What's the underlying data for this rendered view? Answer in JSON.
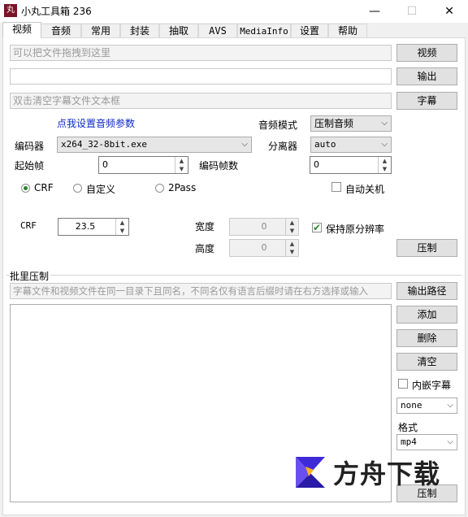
{
  "window": {
    "title": "小丸工具箱 236",
    "app_icon": "丸",
    "minimize": "—",
    "maximize": "☐",
    "close": "✕"
  },
  "tabs": [
    "视频",
    "音频",
    "常用",
    "封装",
    "抽取",
    "AVS",
    "MediaInfo",
    "设置",
    "帮助"
  ],
  "video": {
    "placeholder_drag": "可以把文件拖拽到这里",
    "video_button": "视频",
    "output_field": "",
    "output_button": "输出",
    "placeholder_subtitle": "双击清空字幕文件文本框",
    "subtitle_button": "字幕",
    "audio_settings_link": "点我设置音频参数",
    "audio_mode_label": "音频模式",
    "audio_mode_value": "压制音频",
    "encoder_label": "编码器",
    "encoder_value": "x264_32-8bit.exe",
    "splitter_label": "分离器",
    "splitter_value": "auto",
    "start_frame_label": "起始帧",
    "start_frame_value": "0",
    "frame_count_label": "编码帧数",
    "frame_count_value": "0",
    "mode_crf": "CRF",
    "mode_custom": "自定义",
    "mode_2pass": "2Pass",
    "auto_shutdown": "自动关机",
    "crf_label": "CRF",
    "crf_value": "23.5",
    "width_label": "宽度",
    "width_value": "0",
    "height_label": "高度",
    "height_value": "0",
    "keep_resolution": "保持原分辨率",
    "encode_button": "压制"
  },
  "batch": {
    "title": "批里压制",
    "placeholder_hint": "字幕文件和视频文件在同一目录下且同名，不同名仅有语言后缀时请在右方选择或输入",
    "output_path_button": "输出路径",
    "add_button": "添加",
    "delete_button": "删除",
    "clear_button": "清空",
    "embed_subtitle": "内嵌字幕",
    "subtitle_lang_value": "none",
    "format_label": "格式",
    "format_value": "mp4",
    "encode_button": "压制"
  },
  "watermark": {
    "text": "方舟下载"
  },
  "colors": {
    "link": "#0a28c8",
    "check": "#2b8a2b",
    "radio_on": "#2b7d2b",
    "watermark_brand": "#3f2bd6"
  },
  "icons": {
    "spin_up": "▲",
    "spin_down": "▼",
    "dropdown": "⌵",
    "checkmark": "✔"
  }
}
